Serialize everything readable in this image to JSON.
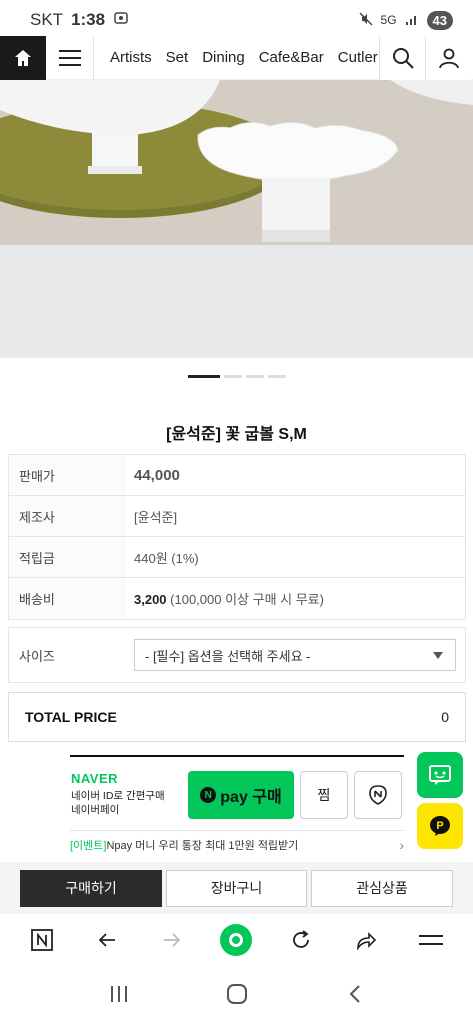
{
  "status_bar": {
    "carrier": "SKT",
    "time": "1:38",
    "network": "5G",
    "battery": "43"
  },
  "topnav": {
    "categories": [
      "Artists",
      "Set",
      "Dining",
      "Cafe&Bar",
      "Cutler"
    ]
  },
  "product": {
    "title": "[윤석준] 꽃 굽볼 S,M",
    "slide_count": 4,
    "active_slide": 1
  },
  "info": {
    "rows": [
      {
        "label": "판매가",
        "value": "44,000"
      },
      {
        "label": "제조사",
        "value": "[윤석준]"
      },
      {
        "label": "적립금",
        "value": "440원 (1%)"
      },
      {
        "label": "배송비",
        "value_bold": "3,200",
        "value": " (100,000 이상 구매 시 무료)"
      }
    ]
  },
  "option": {
    "label": "사이즈",
    "selected": "- [필수] 옵션을 선택해 주세요 -"
  },
  "total": {
    "label": "TOTAL PRICE",
    "value": "0"
  },
  "naverpay": {
    "logo": "NAVER",
    "desc_line1": "네이버 ID로 간편구매",
    "desc_line2": "네이버페이",
    "pay_n": "N",
    "pay_label": "pay 구매",
    "jjim": "찜",
    "event_tag": "[이벤트]",
    "event_text": "Npay 머니 우리 통장 최대 1만원 적립받기"
  },
  "buttons": {
    "buy": "구매하기",
    "cart": "장바구니",
    "wish": "관심상품"
  },
  "colors": {
    "price": "#d0021b",
    "naver_green": "#03c75a",
    "kakao_yellow": "#fee500",
    "dark": "#1a1a1a"
  }
}
